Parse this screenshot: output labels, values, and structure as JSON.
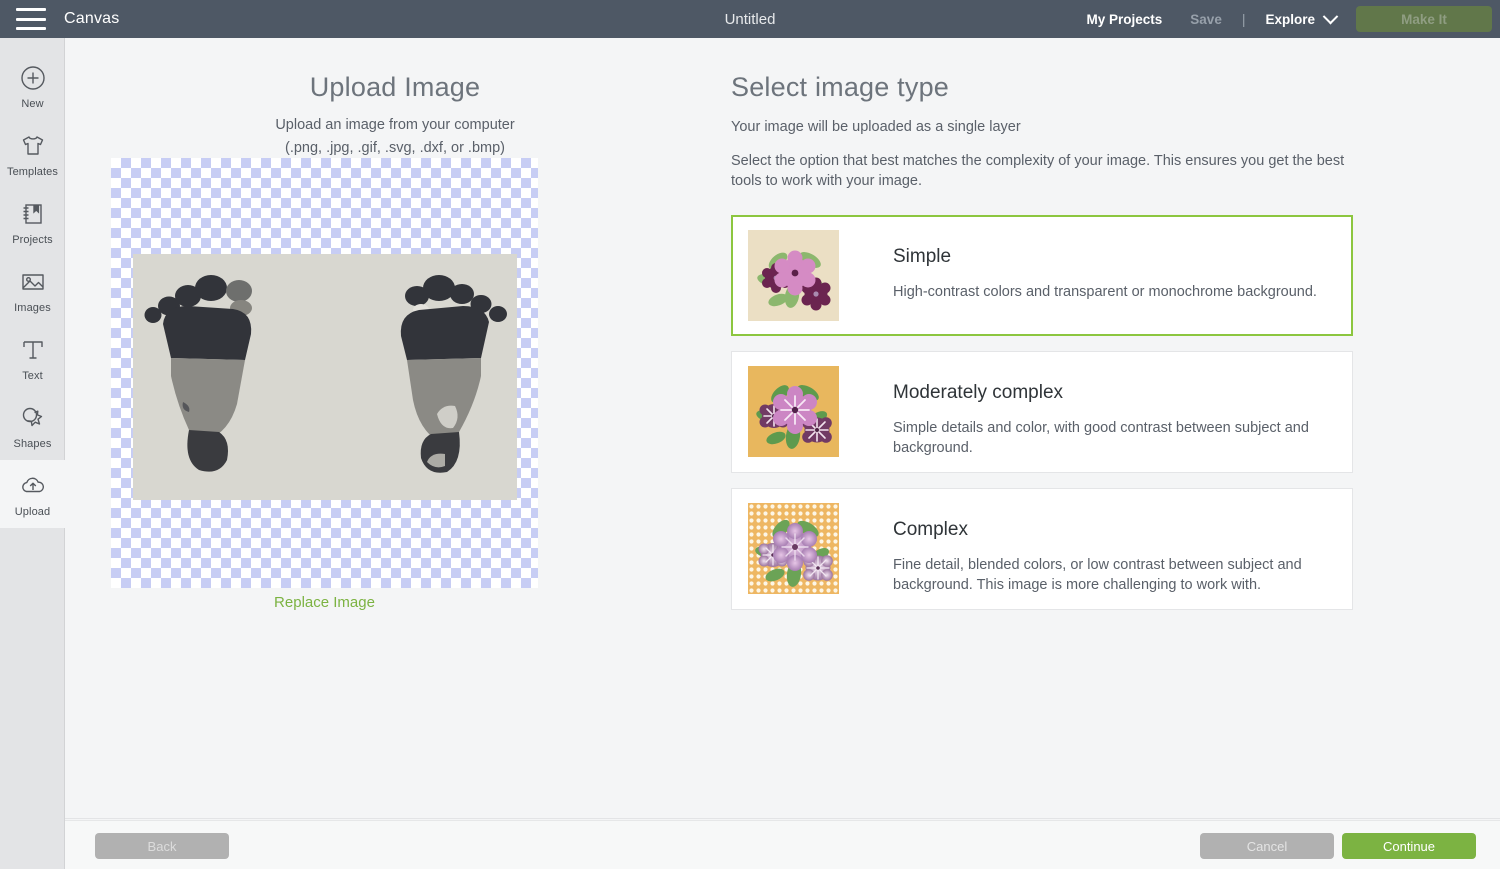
{
  "header": {
    "menu_icon": "hamburger-menu-icon",
    "brand": "Canvas",
    "document_title": "Untitled",
    "my_projects": "My Projects",
    "save": "Save",
    "separator": "|",
    "explore": "Explore",
    "explore_chevron": "chevron-down-icon",
    "make_it": "Make It",
    "bar_color": "#4e5865",
    "make_it_color": "#61774a"
  },
  "sidebar": {
    "items": [
      {
        "label": "New",
        "icon": "plus-circle-icon",
        "active": false
      },
      {
        "label": "Templates",
        "icon": "tshirt-icon",
        "active": false
      },
      {
        "label": "Projects",
        "icon": "notebook-bookmark-icon",
        "active": false
      },
      {
        "label": "Images",
        "icon": "picture-icon",
        "active": false
      },
      {
        "label": "Text",
        "icon": "text-t-icon",
        "active": false
      },
      {
        "label": "Shapes",
        "icon": "shapes-star-icon",
        "active": false
      },
      {
        "label": "Upload",
        "icon": "cloud-upload-icon",
        "active": true
      }
    ]
  },
  "upload_panel": {
    "title": "Upload Image",
    "subtitle": "Upload an image from your computer",
    "formats": "(.png, .jpg, .gif, .svg, .dxf, or .bmp)",
    "replace_link": "Replace Image",
    "link_color": "#7cb342",
    "preview": {
      "checker_color": "#c7cdf4",
      "photo_background": "#d8d7d0",
      "alt": "Two baby footprints in black ink on a light gray background"
    }
  },
  "type_panel": {
    "title": "Select image type",
    "subtitle": "Your image will be uploaded as a single layer",
    "description": "Select the option that best matches the complexity of your image. This ensures you get the best tools to work with your image.",
    "selected_index": 0,
    "selected_border_color": "#8cc63f",
    "options": [
      {
        "title": "Simple",
        "description": "High-contrast colors and transparent or monochrome background.",
        "thumb_background": "#ebdfc4",
        "thumb_style": "flat",
        "selected": true
      },
      {
        "title": "Moderately complex",
        "description": "Simple details and color, with good contrast between subject and background.",
        "thumb_background": "#e8b75e",
        "thumb_style": "detailed",
        "selected": false
      },
      {
        "title": "Complex",
        "description": "Fine detail, blended colors, or low contrast between subject and background. This image is more challenging to work with.",
        "thumb_background": "#eeb763",
        "thumb_style": "dotted",
        "selected": false
      }
    ]
  },
  "footer": {
    "back": "Back",
    "cancel": "Cancel",
    "continue": "Continue",
    "continue_color": "#7cb342",
    "disabled_color": "#b1b1b1"
  }
}
